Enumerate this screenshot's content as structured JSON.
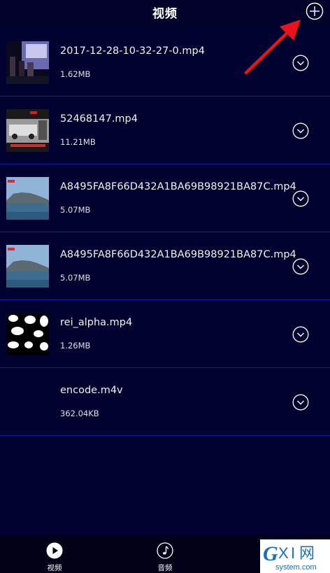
{
  "header": {
    "title": "视频"
  },
  "videos": [
    {
      "name": "2017-12-28-10-32-27-0.mp4",
      "size": "1.62MB",
      "thumb": "dark-scene"
    },
    {
      "name": "52468147.mp4",
      "size": "11.21MB",
      "thumb": "street-car-scene"
    },
    {
      "name": "A8495FA8F66D432A1BA69B98921BA87C.mp4",
      "size": "5.07MB",
      "thumb": "mountain-sea"
    },
    {
      "name": "A8495FA8F66D432A1BA69B98921BA87C.mp4",
      "size": "5.07MB",
      "thumb": "mountain-sea"
    },
    {
      "name": "rei_alpha.mp4",
      "size": "1.26MB",
      "thumb": "alpha-mask"
    },
    {
      "name": "encode.m4v",
      "size": "362.04KB",
      "thumb": "none"
    }
  ],
  "tabs": [
    {
      "label": "视频",
      "icon": "play-icon"
    },
    {
      "label": "音频",
      "icon": "music-note-icon"
    }
  ],
  "watermark": {
    "logo": "GXI网",
    "site": "system.com"
  },
  "colors": {
    "background": "#020230",
    "divider": "#1a1aa0",
    "arrow": "#e8141c"
  }
}
